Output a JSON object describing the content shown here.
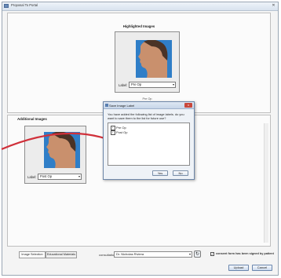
{
  "window": {
    "title": "Proposal To Portal",
    "close_label": "✕"
  },
  "highlighted": {
    "title": "Highlighted Images",
    "label_prefix": "Label:",
    "selected_label": "Pre Op",
    "caption": "Pre Op"
  },
  "additional": {
    "title": "Additional Images",
    "label_prefix": "Label:",
    "selected_label": "Post Op"
  },
  "dialog": {
    "title": "Save Image Label",
    "close_label": "x",
    "message": "You have added the following list of image labels. do you want to save them to the list for future use?",
    "items": [
      {
        "label": "Pre Op",
        "checked": true
      },
      {
        "label": "Post Op",
        "checked": true
      }
    ],
    "yes_label": "Yes",
    "no_label": "No"
  },
  "footer": {
    "tabs": [
      "Image Selection",
      "Educational Materials"
    ],
    "consultation_label": "consultation by",
    "consultation_value": "Dr. Nicholas Riviera",
    "consent_label": "consent form has been signed by patient",
    "consent_checked": true,
    "upload_label": "Upload",
    "cancel_label": "Cancel"
  },
  "colors": {
    "accent": "#d0303a",
    "photo_bg": "#2f7ec7",
    "window_border": "#9aa6b4"
  }
}
